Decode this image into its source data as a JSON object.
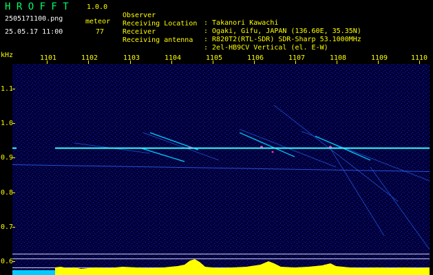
{
  "app": {
    "name": "H R O F F T",
    "version": "1.0.0",
    "filename": "2505171100.png",
    "timestamp": "25.05.17 11:00",
    "meteor_label": "meteor",
    "meteor_count": "77"
  },
  "info": {
    "rows": [
      {
        "label": "Observer",
        "value": ": Takanori Kawachi"
      },
      {
        "label": "Receiving Location",
        "value": ": Ogaki, Gifu, JAPAN (136.60E, 35.35N)"
      },
      {
        "label": "Receiver",
        "value": ": R820T2(RTL-SDR) SDR-Sharp 53.1000MHz"
      },
      {
        "label": "Receiving antenna",
        "value": ": 2el-HB9CV Vertical (el. E-W)"
      }
    ]
  },
  "axes": {
    "y_unit": "kHz",
    "x_ticks": [
      "1101",
      "1102",
      "1103",
      "1104",
      "1105",
      "1106",
      "1107",
      "1108",
      "1109",
      "1110"
    ],
    "y_ticks": [
      "1.1",
      "1.0",
      "0.9",
      "0.8",
      "0.7",
      "0.6"
    ]
  },
  "colors": {
    "label_yellow": "#ffff00",
    "meteor_green": "#00ff66",
    "plot_bg": "#00003a",
    "carrier_cyan": "#33ffff",
    "signal_cyan": "#00ccff",
    "level_yellow": "#ffff00"
  }
}
